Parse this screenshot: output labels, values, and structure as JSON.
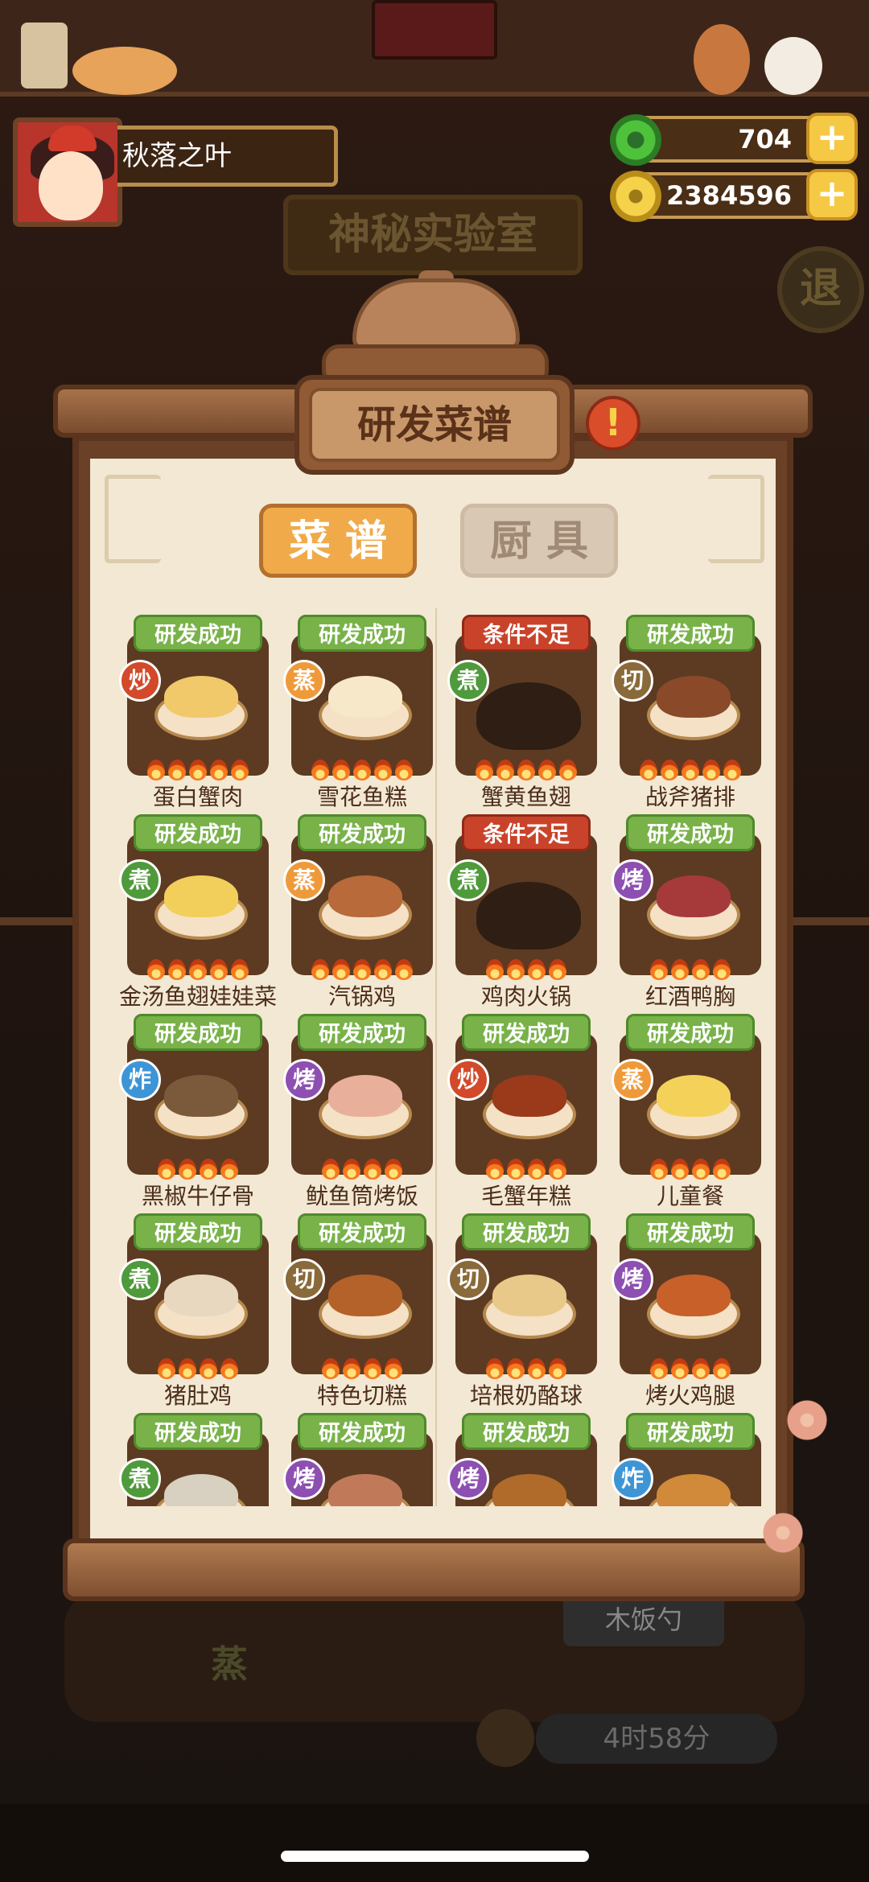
{
  "player": {
    "name": "秋落之叶"
  },
  "currency": {
    "jade": "704",
    "coins": "2384596"
  },
  "background": {
    "lab_title": "神秘实验室",
    "exit_label": "退",
    "utensil_label": "木饭勺",
    "steam_char": "蒸",
    "timer": "4时58分"
  },
  "panel": {
    "title": "研发菜谱",
    "info_icon": "!",
    "tabs": [
      {
        "label": "菜 谱",
        "active": true
      },
      {
        "label": "厨 具",
        "active": false
      }
    ]
  },
  "status_labels": {
    "success": "研发成功",
    "fail": "条件不足"
  },
  "recipes": [
    {
      "name": "蛋白蟹肉",
      "status": "研发成功",
      "method": "炒",
      "flames": 5,
      "food_color": "#f1c86a"
    },
    {
      "name": "雪花鱼糕",
      "status": "研发成功",
      "method": "蒸",
      "flames": 5,
      "food_color": "#f6e8c8"
    },
    {
      "name": "蟹黄鱼翅",
      "status": "条件不足",
      "method": "煮",
      "flames": 5,
      "food_color": ""
    },
    {
      "name": "战斧猪排",
      "status": "研发成功",
      "method": "切",
      "flames": 5,
      "food_color": "#8a4a2a"
    },
    {
      "name": "金汤鱼翅娃娃菜",
      "status": "研发成功",
      "method": "煮",
      "flames": 5,
      "food_color": "#f2cf5a"
    },
    {
      "name": "汽锅鸡",
      "status": "研发成功",
      "method": "蒸",
      "flames": 5,
      "food_color": "#b86a3a"
    },
    {
      "name": "鸡肉火锅",
      "status": "条件不足",
      "method": "煮",
      "flames": 4,
      "food_color": ""
    },
    {
      "name": "红酒鸭胸",
      "status": "研发成功",
      "method": "烤",
      "flames": 4,
      "food_color": "#a63a3a"
    },
    {
      "name": "黑椒牛仔骨",
      "status": "研发成功",
      "method": "炸",
      "flames": 4,
      "food_color": "#7a5a3a"
    },
    {
      "name": "鱿鱼筒烤饭",
      "status": "研发成功",
      "method": "烤",
      "flames": 4,
      "food_color": "#e8b09a"
    },
    {
      "name": "毛蟹年糕",
      "status": "研发成功",
      "method": "炒",
      "flames": 4,
      "food_color": "#9a3a1a"
    },
    {
      "name": "儿童餐",
      "status": "研发成功",
      "method": "蒸",
      "flames": 4,
      "food_color": "#f4d25a"
    },
    {
      "name": "猪肚鸡",
      "status": "研发成功",
      "method": "煮",
      "flames": 4,
      "food_color": "#e8d8c0"
    },
    {
      "name": "特色切糕",
      "status": "研发成功",
      "method": "切",
      "flames": 4,
      "food_color": "#b4622a"
    },
    {
      "name": "培根奶酪球",
      "status": "研发成功",
      "method": "切",
      "flames": 4,
      "food_color": "#e8c98a"
    },
    {
      "name": "烤火鸡腿",
      "status": "研发成功",
      "method": "烤",
      "flames": 4,
      "food_color": "#c8602a"
    },
    {
      "name": "",
      "status": "研发成功",
      "method": "煮",
      "flames": 0,
      "food_color": "#d8d0c0"
    },
    {
      "name": "",
      "status": "研发成功",
      "method": "烤",
      "flames": 0,
      "food_color": "#c07a5a"
    },
    {
      "name": "",
      "status": "研发成功",
      "method": "烤",
      "flames": 0,
      "food_color": "#b06a2a"
    },
    {
      "name": "",
      "status": "研发成功",
      "method": "炸",
      "flames": 0,
      "food_color": "#d08a3a"
    }
  ],
  "colors": {
    "success_badge": "#78b248",
    "fail_badge": "#c9432a",
    "active_tab": "#f0aa4a",
    "paper": "#f3e8d3"
  },
  "icons": {
    "jade": "jade-coin-icon",
    "coin": "gold-coin-icon",
    "plus": "plus-icon",
    "info": "exclamation-icon",
    "flame": "flame-icon"
  }
}
